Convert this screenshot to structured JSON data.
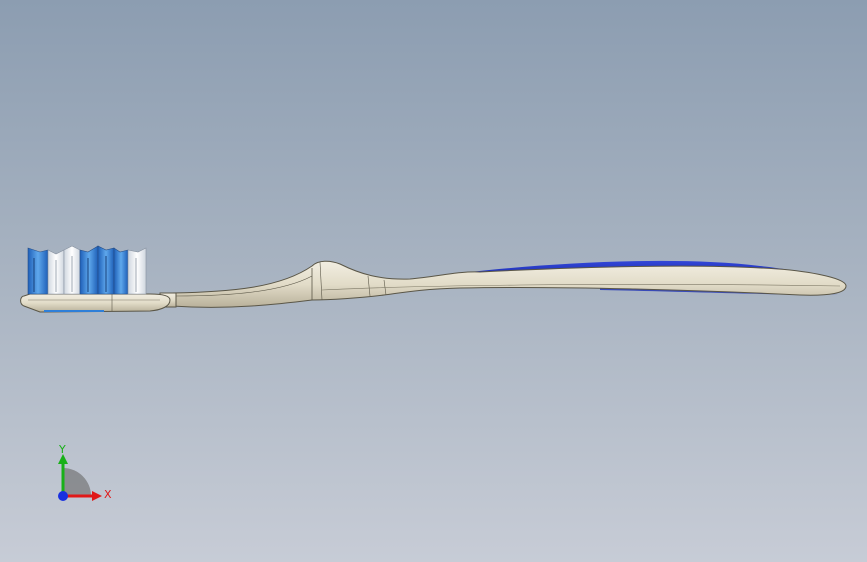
{
  "viewport": {
    "background_top": "#8c9db1",
    "background_bottom": "#c7ccd6"
  },
  "model": {
    "handle_color": "#e2dcc8",
    "grip_color": "#1b2fb5",
    "bristle_colors": [
      "#2f7fd8",
      "#ffffff",
      "#9fd0f0"
    ]
  },
  "triad": {
    "x_label": "X",
    "y_label": "Y",
    "x_color": "#e01818",
    "y_color": "#18b018",
    "z_color": "#1830e0"
  }
}
